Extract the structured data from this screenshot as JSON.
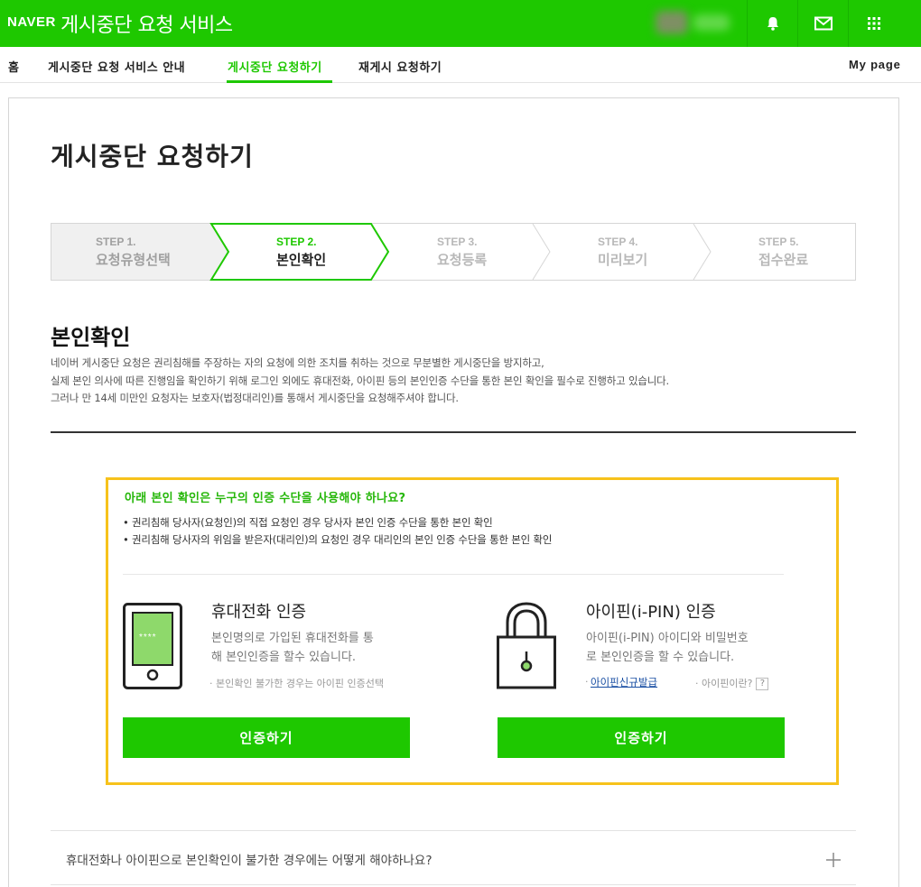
{
  "header": {
    "logo": "NAVER",
    "service_title": "게시중단 요청 서비스",
    "icons": [
      "bell-icon",
      "mail-icon",
      "apps-grid-icon"
    ]
  },
  "nav": {
    "home": "홈",
    "guide": "게시중단 요청 서비스 안내",
    "request": "게시중단 요청하기",
    "repost": "재게시 요청하기",
    "mypage": "My page"
  },
  "page_title": "게시중단 요청하기",
  "steps": [
    {
      "label": "STEP 1.",
      "name": "요청유형선택",
      "state": "done"
    },
    {
      "label": "STEP 2.",
      "name": "본인확인",
      "state": "active"
    },
    {
      "label": "STEP 3.",
      "name": "요청등록",
      "state": "todo"
    },
    {
      "label": "STEP 4.",
      "name": "미리보기",
      "state": "todo"
    },
    {
      "label": "STEP 5.",
      "name": "접수완료",
      "state": "todo"
    }
  ],
  "section": {
    "title": "본인확인",
    "desc": [
      "네이버 게시중단 요청은 권리침해를 주장하는 자의 요청에 의한 조치를 취하는 것으로 무분별한 게시중단을 방지하고,",
      "실제 본인 의사에 따른 진행임을 확인하기 위해 로그인 외에도 휴대전화, 아이핀 등의 본인인증 수단을 통한 본인 확인을 필수로 진행하고 있습니다.",
      "그러나 만 14세 미만인 요청자는 보호자(법정대리인)를 통해서 게시중단을 요청해주셔야 합니다."
    ]
  },
  "auth_box": {
    "question": "아래 본인 확인은 누구의 인증 수단을 사용해야 하나요?",
    "lines": [
      "• 권리침해 당사자(요청인)의 직접 요청인 경우 당사자 본인 인증 수단을 통한 본인 확인",
      "• 권리침해 당사자의 위임을 받은자(대리인)의 요청인 경우 대리인의 본인 인증 수단을 통한 본인 확인"
    ],
    "phone": {
      "title": "휴대전화 인증",
      "desc": [
        "본인명의로 가입된 휴대전화를 통",
        "해 본인인증을 할수 있습니다."
      ],
      "note": "· 본인확인 불가한 경우는 아이핀 인증선택",
      "screen_text": "****",
      "button": "인증하기"
    },
    "ipin": {
      "title": "아이핀(i-PIN) 인증",
      "desc": [
        "아이핀(i-PIN) 아이디와 비밀번호",
        "로 본인인증을 할 수 있습니다."
      ],
      "link_bullet": "·",
      "link": "아이핀신규발급",
      "help": "· 아이핀이란?",
      "help_q": "?",
      "button": "인증하기"
    }
  },
  "faq": {
    "question": "휴대전화나 아이핀으로 본인확인이 불가한 경우에는 어떻게 해야하나요?"
  },
  "colors": {
    "brand": "#1ec800",
    "highlight_border": "#f7c21b",
    "link": "#1a4fa3"
  }
}
